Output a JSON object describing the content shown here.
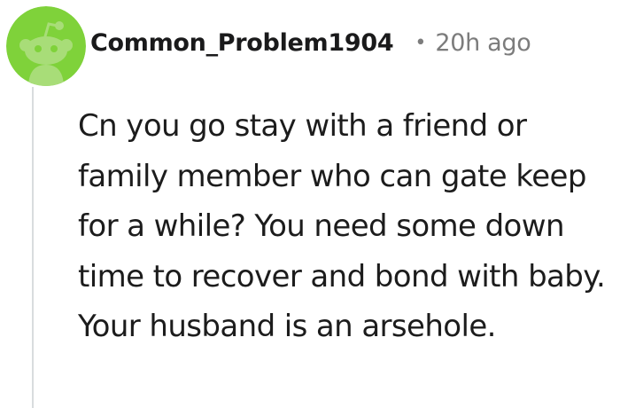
{
  "comment": {
    "author": "Common_Problem1904",
    "separator": "•",
    "timestamp": "20h ago",
    "body": "Cn you go stay with a friend or family member who can gate keep for a while? You need some down time to recover and bond with baby. Your husband is an arsehole."
  },
  "avatar": {
    "icon": "reddit-snoo-icon",
    "background_color": "#7fd23a",
    "snoo_color": "#a8dd78"
  }
}
